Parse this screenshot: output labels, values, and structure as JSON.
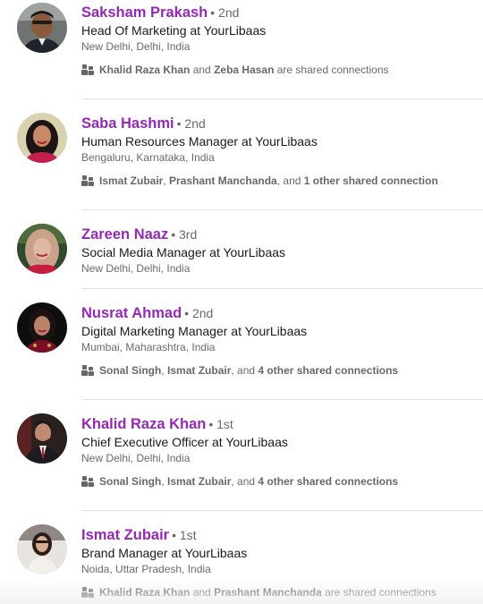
{
  "colors": {
    "name": "#9429b5",
    "text": "#1d1d1d",
    "muted": "#666666",
    "divider": "#e4e4e4"
  },
  "results": [
    {
      "name": "Saksham Prakash",
      "degree": "• 2nd",
      "headline": "Head Of Marketing at YourLibaas",
      "location": "New Delhi, Delhi, India",
      "avatar_icon": "profile-photo",
      "shared": {
        "icon": "people-icon",
        "parts": [
          {
            "text": "Khalid Raza Khan",
            "bold": true
          },
          {
            "text": " and ",
            "bold": false
          },
          {
            "text": "Zeba Hasan",
            "bold": true
          },
          {
            "text": " are shared connections",
            "bold": false
          }
        ]
      }
    },
    {
      "name": "Saba Hashmi",
      "degree": "• 2nd",
      "headline": "Human Resources Manager at YourLibaas",
      "location": "Bengaluru, Karnataka, India",
      "avatar_icon": "profile-photo",
      "shared": {
        "icon": "people-icon",
        "parts": [
          {
            "text": "Ismat Zubair",
            "bold": true
          },
          {
            "text": ", ",
            "bold": false
          },
          {
            "text": "Prashant Manchanda",
            "bold": true
          },
          {
            "text": ", and ",
            "bold": false
          },
          {
            "text": "1 other shared connection",
            "bold": true
          }
        ]
      }
    },
    {
      "name": "Zareen Naaz",
      "degree": "• 3rd",
      "headline": "Social Media Manager at YourLibaas",
      "location": "New Delhi, Delhi, India",
      "avatar_icon": "profile-photo",
      "shared": null
    },
    {
      "name": "Nusrat Ahmad",
      "degree": "• 2nd",
      "headline": "Digital Marketing Manager at YourLibaas",
      "location": "Mumbai, Maharashtra, India",
      "avatar_icon": "profile-photo",
      "shared": {
        "icon": "people-icon",
        "parts": [
          {
            "text": "Sonal Singh",
            "bold": true
          },
          {
            "text": ", ",
            "bold": false
          },
          {
            "text": "Ismat Zubair",
            "bold": true
          },
          {
            "text": ", and ",
            "bold": false
          },
          {
            "text": "4 other shared connections",
            "bold": true
          }
        ]
      }
    },
    {
      "name": "Khalid Raza Khan",
      "degree": "• 1st",
      "headline": "Chief Executive Officer at YourLibaas",
      "location": "New Delhi, Delhi, India",
      "avatar_icon": "profile-photo",
      "shared": {
        "icon": "people-icon",
        "parts": [
          {
            "text": "Sonal Singh",
            "bold": true
          },
          {
            "text": ", ",
            "bold": false
          },
          {
            "text": "Ismat Zubair",
            "bold": true
          },
          {
            "text": ", and ",
            "bold": false
          },
          {
            "text": "4 other shared connections",
            "bold": true
          }
        ]
      }
    },
    {
      "name": "Ismat Zubair",
      "degree": "• 1st",
      "headline": "Brand Manager at YourLibaas",
      "location": "Noida, Uttar Pradesh, India",
      "avatar_icon": "profile-photo",
      "shared": {
        "icon": "people-icon",
        "parts": [
          {
            "text": "Khalid Raza Khan",
            "bold": true
          },
          {
            "text": " and ",
            "bold": false
          },
          {
            "text": "Prashant Manchanda",
            "bold": true
          },
          {
            "text": " are shared connections",
            "bold": false
          }
        ]
      }
    }
  ]
}
